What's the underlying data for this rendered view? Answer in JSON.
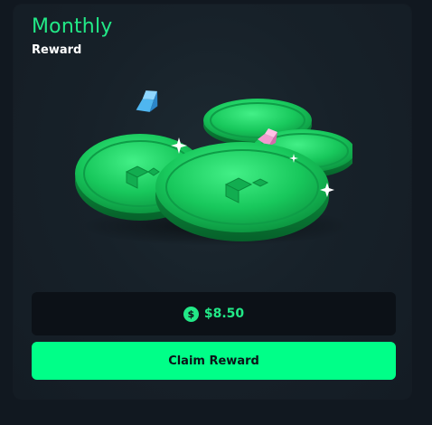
{
  "card": {
    "title": "Monthly",
    "subtitle": "Reward",
    "illustration_icon": "green-coins-stack-icon",
    "amount": {
      "currency_icon": "dollar-circle-icon",
      "currency_symbol": "$",
      "value": "$8.50"
    },
    "claim_button_label": "Claim Reward"
  },
  "colors": {
    "accent": "#22e987",
    "button": "#00ff88",
    "card_background": "#172129",
    "page_background": "#111820"
  }
}
